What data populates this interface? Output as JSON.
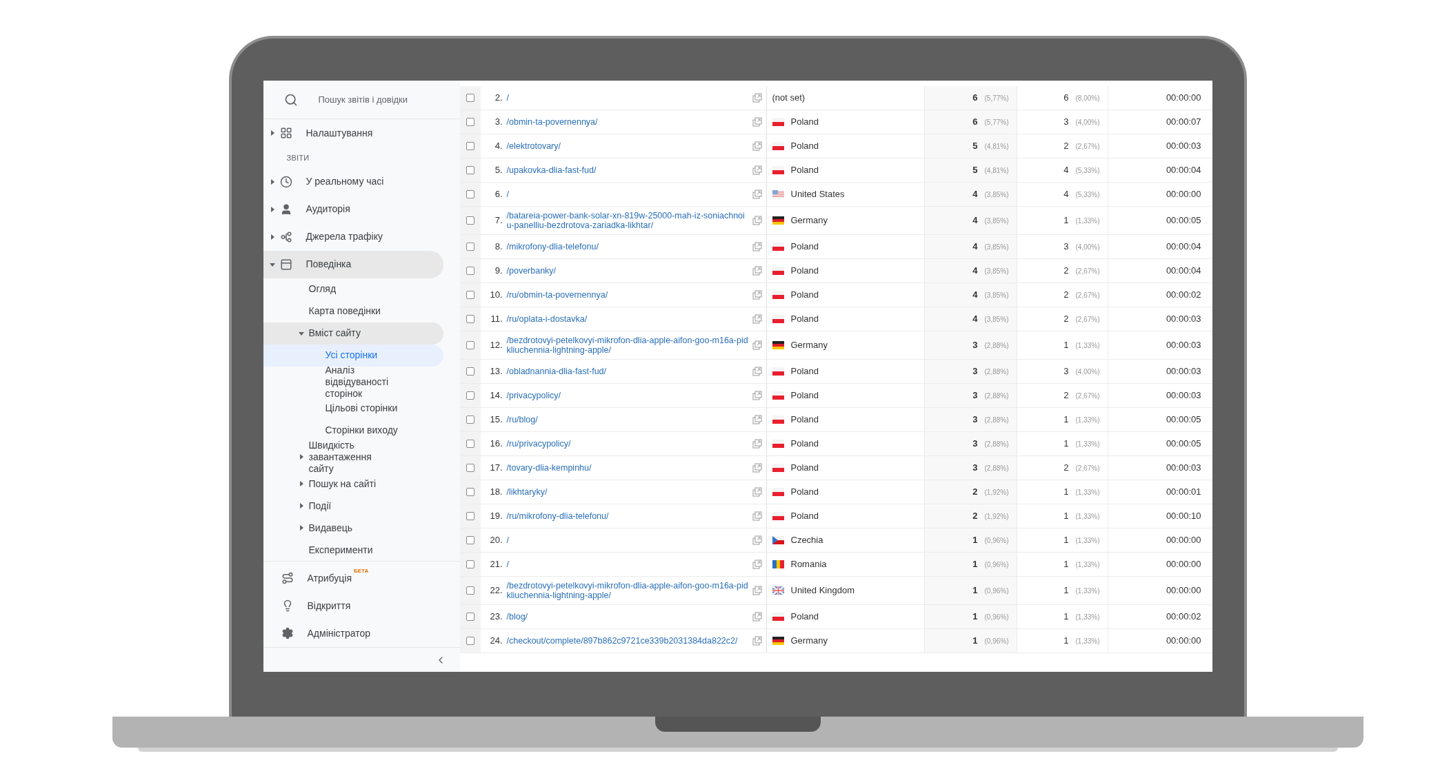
{
  "sidebar": {
    "search": {
      "placeholder": "Пошук звітів і довідки"
    },
    "top_items": [
      {
        "label": "Налаштування",
        "kind": "grid-plus",
        "expanded": false,
        "selected": false
      }
    ],
    "section_heading": "ЗВІТИ",
    "items": [
      {
        "label": "У реальному часі",
        "kind": "clock",
        "expanded": false,
        "selected": false
      },
      {
        "label": "Аудиторія",
        "kind": "person",
        "expanded": false,
        "selected": false
      },
      {
        "label": "Джерела трафіку",
        "kind": "fork",
        "expanded": false,
        "selected": false
      },
      {
        "label": "Поведінка",
        "kind": "window",
        "expanded": true,
        "selected": false,
        "children": [
          {
            "label": "Огляд",
            "selected": false
          },
          {
            "label": "Карта поведінки",
            "selected": false
          },
          {
            "label": "Вміст сайту",
            "expanded": true,
            "selected": false,
            "children": [
              {
                "label": "Усі сторінки",
                "selected": true
              },
              {
                "label": "Аналіз відвідуваності сторінок",
                "selected": false
              },
              {
                "label": "Цільові сторінки",
                "selected": false
              },
              {
                "label": "Сторінки виходу",
                "selected": false
              }
            ]
          },
          {
            "label": "Швидкість завантаження сайту",
            "expanded": false,
            "selected": false
          },
          {
            "label": "Пошук на сайті",
            "expanded": false,
            "selected": false
          },
          {
            "label": "Події",
            "expanded": false,
            "selected": false
          },
          {
            "label": "Видавець",
            "expanded": false,
            "selected": false
          },
          {
            "label": "Експерименти",
            "selected": false
          }
        ]
      }
    ],
    "bottom_items": [
      {
        "label": "Атрибуція",
        "kind": "route",
        "badge": "БЕТА"
      },
      {
        "label": "Відкриття",
        "kind": "bulb"
      },
      {
        "label": "Адміністратор",
        "kind": "gear"
      }
    ]
  },
  "table": {
    "rows": [
      {
        "checked": false,
        "index": "2.",
        "page": "/",
        "country": {
          "name": "(not set)"
        },
        "sessions": "6",
        "sessions_pct": "(5,77%)",
        "users": "6",
        "users_pct": "(8,00%)",
        "time": "00:00:00"
      },
      {
        "checked": false,
        "index": "3.",
        "page": "/obmin-ta-povernennya/",
        "country": {
          "name": "Poland",
          "kind": "pl"
        },
        "sessions": "6",
        "sessions_pct": "(5,77%)",
        "users": "3",
        "users_pct": "(4,00%)",
        "time": "00:00:07"
      },
      {
        "checked": false,
        "index": "4.",
        "page": "/elektrotovary/",
        "country": {
          "name": "Poland",
          "kind": "pl"
        },
        "sessions": "5",
        "sessions_pct": "(4,81%)",
        "users": "2",
        "users_pct": "(2,67%)",
        "time": "00:00:03"
      },
      {
        "checked": false,
        "index": "5.",
        "page": "/upakovka-dlia-fast-fud/",
        "country": {
          "name": "Poland",
          "kind": "pl"
        },
        "sessions": "5",
        "sessions_pct": "(4,81%)",
        "users": "4",
        "users_pct": "(5,33%)",
        "time": "00:00:04"
      },
      {
        "checked": false,
        "index": "6.",
        "page": "/",
        "country": {
          "name": "United States",
          "kind": "us"
        },
        "sessions": "4",
        "sessions_pct": "(3,85%)",
        "users": "4",
        "users_pct": "(5,33%)",
        "time": "00:00:00"
      },
      {
        "checked": false,
        "index": "7.",
        "page": "/batareia-power-bank-solar-xn-819w-25000-mah-iz-soniachnoiu-panelliu-bezdrotova-zariadka-likhtar/",
        "country": {
          "name": "Germany",
          "kind": "de"
        },
        "sessions": "4",
        "sessions_pct": "(3,85%)",
        "users": "1",
        "users_pct": "(1,33%)",
        "time": "00:00:05"
      },
      {
        "checked": false,
        "index": "8.",
        "page": "/mikrofony-dlia-telefonu/",
        "country": {
          "name": "Poland",
          "kind": "pl"
        },
        "sessions": "4",
        "sessions_pct": "(3,85%)",
        "users": "3",
        "users_pct": "(4,00%)",
        "time": "00:00:04"
      },
      {
        "checked": false,
        "index": "9.",
        "page": "/poverbanky/",
        "country": {
          "name": "Poland",
          "kind": "pl"
        },
        "sessions": "4",
        "sessions_pct": "(3,85%)",
        "users": "2",
        "users_pct": "(2,67%)",
        "time": "00:00:04"
      },
      {
        "checked": false,
        "index": "10.",
        "page": "/ru/obmin-ta-povernennya/",
        "country": {
          "name": "Poland",
          "kind": "pl"
        },
        "sessions": "4",
        "sessions_pct": "(3,85%)",
        "users": "2",
        "users_pct": "(2,67%)",
        "time": "00:00:02"
      },
      {
        "checked": false,
        "index": "11.",
        "page": "/ru/oplata-i-dostavka/",
        "country": {
          "name": "Poland",
          "kind": "pl"
        },
        "sessions": "4",
        "sessions_pct": "(3,85%)",
        "users": "2",
        "users_pct": "(2,67%)",
        "time": "00:00:03"
      },
      {
        "checked": false,
        "index": "12.",
        "page": "/bezdrotovyi-petelkovyi-mikrofon-dlia-apple-aifon-goo-m16a-pidkliuchennia-lightning-apple/",
        "country": {
          "name": "Germany",
          "kind": "de"
        },
        "sessions": "3",
        "sessions_pct": "(2,88%)",
        "users": "1",
        "users_pct": "(1,33%)",
        "time": "00:00:03"
      },
      {
        "checked": false,
        "index": "13.",
        "page": "/obladnannia-dlia-fast-fud/",
        "country": {
          "name": "Poland",
          "kind": "pl"
        },
        "sessions": "3",
        "sessions_pct": "(2,88%)",
        "users": "3",
        "users_pct": "(4,00%)",
        "time": "00:00:03"
      },
      {
        "checked": false,
        "index": "14.",
        "page": "/privacypolicy/",
        "country": {
          "name": "Poland",
          "kind": "pl"
        },
        "sessions": "3",
        "sessions_pct": "(2,88%)",
        "users": "2",
        "users_pct": "(2,67%)",
        "time": "00:00:03"
      },
      {
        "checked": false,
        "index": "15.",
        "page": "/ru/blog/",
        "country": {
          "name": "Poland",
          "kind": "pl"
        },
        "sessions": "3",
        "sessions_pct": "(2,88%)",
        "users": "1",
        "users_pct": "(1,33%)",
        "time": "00:00:05"
      },
      {
        "checked": false,
        "index": "16.",
        "page": "/ru/privacypolicy/",
        "country": {
          "name": "Poland",
          "kind": "pl"
        },
        "sessions": "3",
        "sessions_pct": "(2,88%)",
        "users": "1",
        "users_pct": "(1,33%)",
        "time": "00:00:05"
      },
      {
        "checked": false,
        "index": "17.",
        "page": "/tovary-dlia-kempinhu/",
        "country": {
          "name": "Poland",
          "kind": "pl"
        },
        "sessions": "3",
        "sessions_pct": "(2,88%)",
        "users": "2",
        "users_pct": "(2,67%)",
        "time": "00:00:03"
      },
      {
        "checked": false,
        "index": "18.",
        "page": "/likhtaryky/",
        "country": {
          "name": "Poland",
          "kind": "pl"
        },
        "sessions": "2",
        "sessions_pct": "(1,92%)",
        "users": "1",
        "users_pct": "(1,33%)",
        "time": "00:00:01"
      },
      {
        "checked": false,
        "index": "19.",
        "page": "/ru/mikrofony-dlia-telefonu/",
        "country": {
          "name": "Poland",
          "kind": "pl"
        },
        "sessions": "2",
        "sessions_pct": "(1,92%)",
        "users": "1",
        "users_pct": "(1,33%)",
        "time": "00:00:10"
      },
      {
        "checked": false,
        "index": "20.",
        "page": "/",
        "country": {
          "name": "Czechia",
          "kind": "cz"
        },
        "sessions": "1",
        "sessions_pct": "(0,96%)",
        "users": "1",
        "users_pct": "(1,33%)",
        "time": "00:00:00"
      },
      {
        "checked": false,
        "index": "21.",
        "page": "/",
        "country": {
          "name": "Romania",
          "kind": "ro"
        },
        "sessions": "1",
        "sessions_pct": "(0,96%)",
        "users": "1",
        "users_pct": "(1,33%)",
        "time": "00:00:00"
      },
      {
        "checked": false,
        "index": "22.",
        "page": "/bezdrotovyi-petelkovyi-mikrofon-dlia-apple-aifon-goo-m16a-pidkliuchennia-lightning-apple/",
        "country": {
          "name": "United Kingdom",
          "kind": "gb"
        },
        "sessions": "1",
        "sessions_pct": "(0,96%)",
        "users": "1",
        "users_pct": "(1,33%)",
        "time": "00:00:00"
      },
      {
        "checked": false,
        "index": "23.",
        "page": "/blog/",
        "country": {
          "name": "Poland",
          "kind": "pl"
        },
        "sessions": "1",
        "sessions_pct": "(0,96%)",
        "users": "1",
        "users_pct": "(1,33%)",
        "time": "00:00:02"
      },
      {
        "checked": false,
        "index": "24.",
        "page": "/checkout/complete/897b862c9721ce339b2031384da822c2/",
        "country": {
          "name": "Germany",
          "kind": "de"
        },
        "sessions": "1",
        "sessions_pct": "(0,96%)",
        "users": "1",
        "users_pct": "(1,33%)",
        "time": "00:00:00"
      }
    ]
  }
}
